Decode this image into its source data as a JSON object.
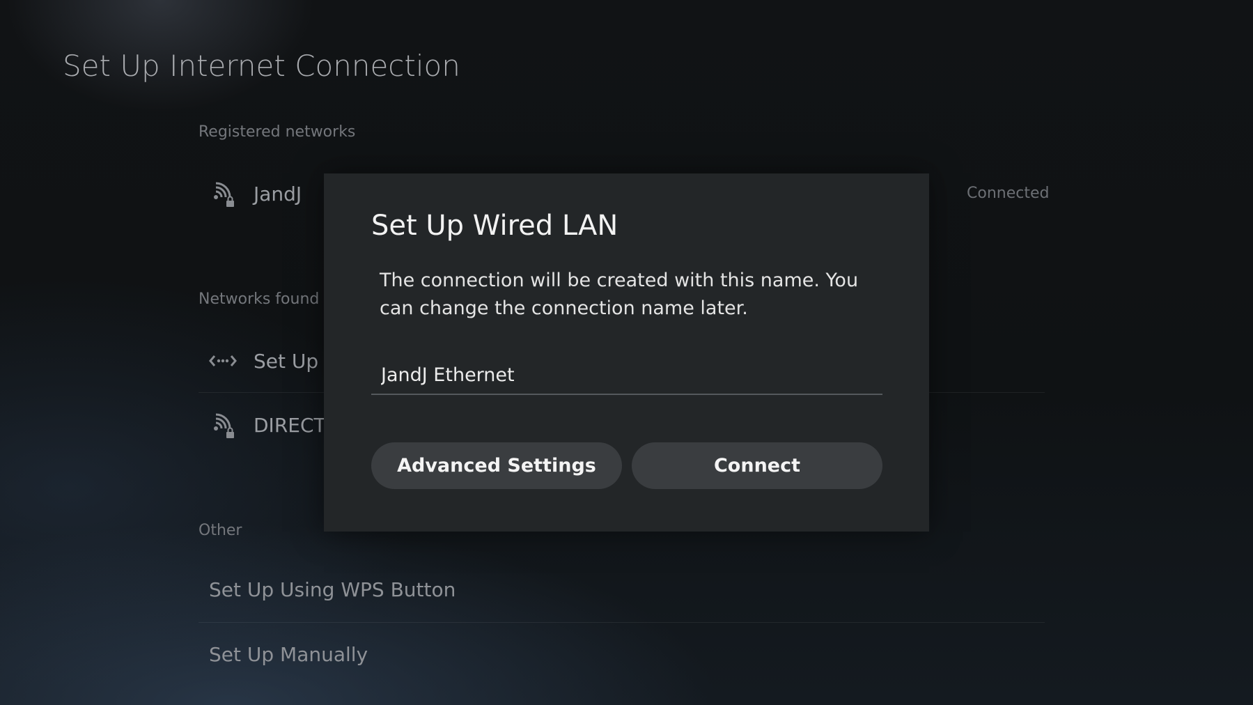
{
  "page": {
    "title": "Set Up Internet Connection"
  },
  "registered": {
    "label": "Registered networks",
    "networks": [
      {
        "name": "JandJ",
        "status": "Connected",
        "icon": "wifi-locked-icon"
      }
    ]
  },
  "found": {
    "label": "Networks found",
    "networks": [
      {
        "name": "Set Up W",
        "icon": "wired-lan-icon"
      },
      {
        "name": "DIRECT-",
        "icon": "wifi-locked-icon"
      }
    ]
  },
  "other": {
    "label": "Other",
    "items": [
      {
        "label": "Set Up Using WPS Button"
      },
      {
        "label": "Set Up Manually"
      }
    ]
  },
  "dialog": {
    "title": "Set Up Wired LAN",
    "message": "The connection will be created with this name. You can change the connection name later.",
    "name_value": "JandJ Ethernet",
    "advanced_label": "Advanced Settings",
    "connect_label": "Connect"
  },
  "colors": {
    "background": "#0f1214",
    "dialog_background": "#232628",
    "button_background": "#3a3d40"
  }
}
